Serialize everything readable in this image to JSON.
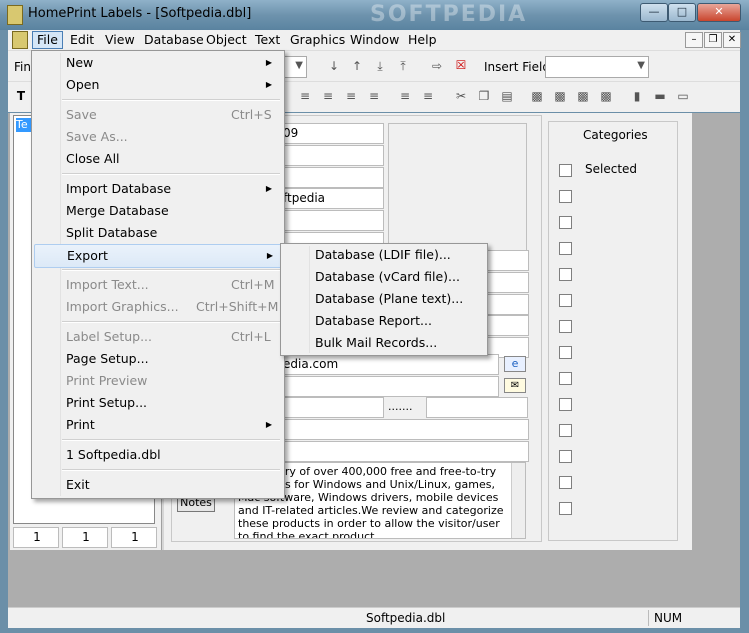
{
  "window": {
    "title": "HomePrint Labels - [Softpedia.dbl]",
    "watermark": "SOFTPEDIA"
  },
  "menubar": [
    "File",
    "Edit",
    "View",
    "Database",
    "Object",
    "Text",
    "Graphics",
    "Window",
    "Help"
  ],
  "toolbar": {
    "find_label": "Find",
    "insert_field_label": "Insert Field:"
  },
  "record_list": {
    "selected_item": "Te",
    "counters": [
      "1",
      "1",
      "1"
    ]
  },
  "form": {
    "field_values": [
      "09",
      "",
      "",
      "ftpedia",
      "",
      "",
      "",
      "",
      "",
      "",
      "",
      "edia.com",
      "",
      "",
      "......."
    ],
    "notes_button": "Notes",
    "notes_text": "is a library of over 400,000 free and free-to-try programs for Windows and Unix/Linux, games, Mac software, Windows drivers, mobile devices and IT-related articles.We review and categorize these products in order to allow the visitor/user to find the exact product"
  },
  "categories": {
    "title": "Categories",
    "selected_label": "Selected"
  },
  "file_menu": {
    "items": [
      {
        "label": "New",
        "shortcut": "",
        "submenu": true,
        "disabled": false
      },
      {
        "label": "Open",
        "shortcut": "",
        "submenu": true,
        "disabled": false
      },
      {
        "label": "Save",
        "shortcut": "Ctrl+S",
        "submenu": false,
        "disabled": true
      },
      {
        "label": "Save As...",
        "shortcut": "",
        "submenu": false,
        "disabled": true
      },
      {
        "label": "Close All",
        "shortcut": "",
        "submenu": false,
        "disabled": false
      },
      {
        "label": "Import Database",
        "shortcut": "",
        "submenu": true,
        "disabled": false
      },
      {
        "label": "Merge Database",
        "shortcut": "",
        "submenu": false,
        "disabled": false
      },
      {
        "label": "Split Database",
        "shortcut": "",
        "submenu": false,
        "disabled": false
      },
      {
        "label": "Export",
        "shortcut": "",
        "submenu": true,
        "disabled": false,
        "highlighted": true
      },
      {
        "label": "Import Text...",
        "shortcut": "Ctrl+M",
        "submenu": false,
        "disabled": true
      },
      {
        "label": "Import Graphics...",
        "shortcut": "Ctrl+Shift+M",
        "submenu": false,
        "disabled": true
      },
      {
        "label": "Label Setup...",
        "shortcut": "Ctrl+L",
        "submenu": false,
        "disabled": true
      },
      {
        "label": "Page Setup...",
        "shortcut": "",
        "submenu": false,
        "disabled": false
      },
      {
        "label": "Print Preview",
        "shortcut": "",
        "submenu": false,
        "disabled": true
      },
      {
        "label": "Print Setup...",
        "shortcut": "",
        "submenu": false,
        "disabled": false
      },
      {
        "label": "Print",
        "shortcut": "",
        "submenu": true,
        "disabled": false
      },
      {
        "label": "1 Softpedia.dbl",
        "shortcut": "",
        "submenu": false,
        "disabled": false
      },
      {
        "label": "Exit",
        "shortcut": "",
        "submenu": false,
        "disabled": false
      }
    ]
  },
  "export_submenu": [
    "Database (LDIF file)...",
    "Database (vCard file)...",
    "Database (Plane text)...",
    "Database Report...",
    "Bulk Mail Records..."
  ],
  "statusbar": {
    "document": "Softpedia.dbl",
    "num": "NUM"
  }
}
